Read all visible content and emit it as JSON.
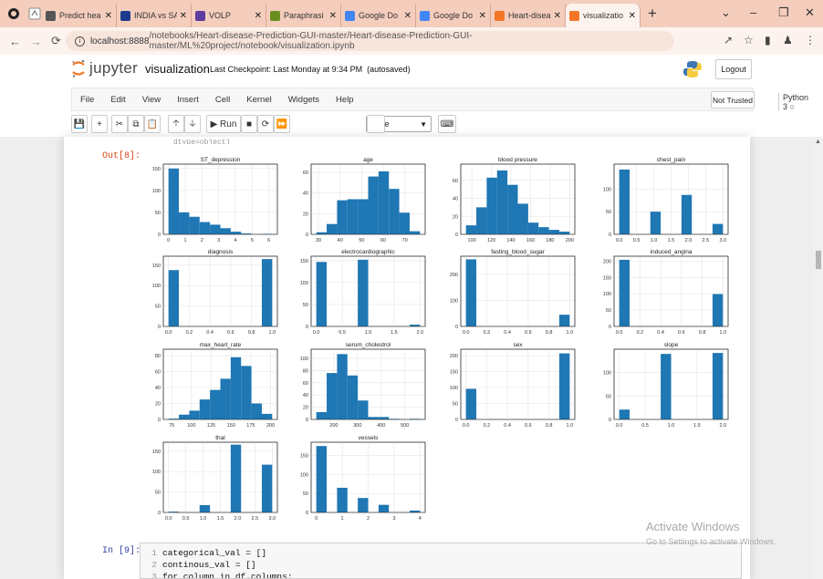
{
  "browser": {
    "tabs": [
      {
        "title": "Predict hea",
        "color": "#555555",
        "icon": "globe-icon"
      },
      {
        "title": "INDIA vs SA",
        "color": "#1a3b8c",
        "icon": "cricket-icon"
      },
      {
        "title": "VOLP",
        "color": "#5e3ca0",
        "icon": "volp-icon"
      },
      {
        "title": "Paraphrasi",
        "color": "#6b8e23",
        "icon": "quill-icon"
      },
      {
        "title": "Google Do",
        "color": "#4285f4",
        "icon": "google-icon"
      },
      {
        "title": "Google Do",
        "color": "#4285f4",
        "icon": "docs-icon"
      },
      {
        "title": "Heart-disea",
        "color": "#f37726",
        "icon": "jupyter-icon"
      },
      {
        "title": "visualizatio",
        "color": "#f37726",
        "icon": "jupyter-icon",
        "active": true
      }
    ],
    "url_host": "localhost:8888",
    "url_path": "/notebooks/Heart-disease-Prediction-GUI-master/Heart-disease-Prediction-GUI-master/ML%20project/notebook/visualization.ipynb"
  },
  "jupyter": {
    "logo_text": "jupyter",
    "notebook_name": "visualization",
    "checkpoint": "Last Checkpoint: Last Monday at 9:34 PM",
    "autosave": "(autosaved)",
    "logout_label": "Logout",
    "menus": [
      "File",
      "Edit",
      "View",
      "Insert",
      "Cell",
      "Kernel",
      "Widgets",
      "Help"
    ],
    "trusted_label": "Not Trusted",
    "kernel_label": "Python 3",
    "run_label": "Run",
    "cell_type": "Code"
  },
  "output_prompt": "Out[8]:",
  "input_prompt": "In [9]:",
  "residue_text": "dtype=object)",
  "code_lines": [
    {
      "n": "1",
      "text": "categorical_val = []"
    },
    {
      "n": "2",
      "text": "continous_val = []"
    },
    {
      "n": "3",
      "text": "for column in df.columns:"
    }
  ],
  "watermark": {
    "line1": "Activate Windows",
    "line2": "Go to Settings to activate Windows."
  },
  "colors": {
    "bar": "#1f77b4",
    "tab_strip": "#f5cdbd",
    "address_bar": "#fdf3ee",
    "out_prompt": "#d84315",
    "in_prompt": "#303f9f"
  },
  "chart_data": [
    {
      "type": "bar",
      "title": "ST_depression",
      "x_ticks": [
        "0",
        "1",
        "2",
        "3",
        "4",
        "5",
        "6"
      ],
      "x_range": [
        0,
        6.2
      ],
      "y_ticks": [
        "0",
        "50",
        "100",
        "150"
      ],
      "y_range": [
        0,
        160
      ],
      "bins": [
        [
          0,
          0.62,
          150
        ],
        [
          0.62,
          1.24,
          50
        ],
        [
          1.24,
          1.86,
          40
        ],
        [
          1.86,
          2.48,
          28
        ],
        [
          2.48,
          3.1,
          22
        ],
        [
          3.1,
          3.72,
          14
        ],
        [
          3.72,
          4.34,
          6
        ],
        [
          4.34,
          4.96,
          2
        ],
        [
          4.96,
          5.58,
          0
        ],
        [
          5.58,
          6.2,
          1
        ]
      ]
    },
    {
      "type": "bar",
      "title": "age",
      "x_ticks": [
        "30",
        "40",
        "50",
        "60",
        "70"
      ],
      "x_range": [
        29,
        77
      ],
      "y_ticks": [
        "0",
        "20",
        "40",
        "60"
      ],
      "y_range": [
        0,
        68
      ],
      "bins": [
        [
          29,
          33.8,
          2
        ],
        [
          33.8,
          38.6,
          10
        ],
        [
          38.6,
          43.4,
          33
        ],
        [
          43.4,
          48.2,
          34
        ],
        [
          48.2,
          53,
          34
        ],
        [
          53,
          57.8,
          56
        ],
        [
          57.8,
          62.6,
          61
        ],
        [
          62.6,
          67.4,
          44
        ],
        [
          67.4,
          72.2,
          21
        ],
        [
          72.2,
          77,
          3
        ]
      ]
    },
    {
      "type": "bar",
      "title": "blood pressure",
      "x_ticks": [
        "100",
        "120",
        "140",
        "160",
        "180",
        "200"
      ],
      "x_range": [
        94,
        200
      ],
      "y_ticks": [
        "0",
        "20",
        "40",
        "60"
      ],
      "y_range": [
        0,
        78
      ],
      "bins": [
        [
          94,
          104.6,
          10
        ],
        [
          104.6,
          115.2,
          30
        ],
        [
          115.2,
          125.8,
          63
        ],
        [
          125.8,
          136.4,
          71
        ],
        [
          136.4,
          147,
          55
        ],
        [
          147,
          157.6,
          34
        ],
        [
          157.6,
          168.2,
          13
        ],
        [
          168.2,
          178.8,
          8
        ],
        [
          178.8,
          189.4,
          5
        ],
        [
          189.4,
          200,
          3
        ]
      ]
    },
    {
      "type": "bar",
      "title": "chest_pain",
      "x_ticks": [
        "0.0",
        "0.5",
        "1.0",
        "1.5",
        "2.0",
        "2.5",
        "3.0"
      ],
      "x_range": [
        0,
        3
      ],
      "y_ticks": [
        "0",
        "50",
        "100"
      ],
      "y_range": [
        0,
        155
      ],
      "bins": [
        [
          0,
          0.3,
          143
        ],
        [
          0.9,
          1.2,
          50
        ],
        [
          1.8,
          2.1,
          87
        ],
        [
          2.7,
          3,
          23
        ]
      ]
    },
    {
      "type": "bar",
      "title": "diagnosis",
      "x_ticks": [
        "0.0",
        "0.2",
        "0.4",
        "0.6",
        "0.8",
        "1.0"
      ],
      "x_range": [
        0,
        1
      ],
      "y_ticks": [
        "0",
        "50",
        "100",
        "150"
      ],
      "y_range": [
        0,
        172
      ],
      "bins": [
        [
          0,
          0.1,
          138
        ],
        [
          0.9,
          1,
          165
        ]
      ]
    },
    {
      "type": "bar",
      "title": "electrocardiographic",
      "x_ticks": [
        "0.0",
        "0.5",
        "1.0",
        "1.5",
        "2.0"
      ],
      "x_range": [
        0,
        2
      ],
      "y_ticks": [
        "0",
        "50",
        "100",
        "150"
      ],
      "y_range": [
        0,
        160
      ],
      "bins": [
        [
          0,
          0.2,
          147
        ],
        [
          0.8,
          1,
          152
        ],
        [
          1.8,
          2,
          4
        ]
      ]
    },
    {
      "type": "bar",
      "title": "fasting_blood_sugar",
      "x_ticks": [
        "0.0",
        "0.2",
        "0.4",
        "0.6",
        "0.8",
        "1.0"
      ],
      "x_range": [
        0,
        1
      ],
      "y_ticks": [
        "0",
        "100",
        "200"
      ],
      "y_range": [
        0,
        270
      ],
      "bins": [
        [
          0,
          0.1,
          258
        ],
        [
          0.9,
          1,
          45
        ]
      ]
    },
    {
      "type": "bar",
      "title": "induced_angina",
      "x_ticks": [
        "0.0",
        "0.2",
        "0.4",
        "0.6",
        "0.8",
        "1.0"
      ],
      "x_range": [
        0,
        1
      ],
      "y_ticks": [
        "0",
        "50",
        "100",
        "150",
        "200"
      ],
      "y_range": [
        0,
        215
      ],
      "bins": [
        [
          0,
          0.1,
          204
        ],
        [
          0.9,
          1,
          99
        ]
      ]
    },
    {
      "type": "bar",
      "title": "max_heart_rate",
      "x_ticks": [
        "75",
        "100",
        "125",
        "150",
        "175",
        "200"
      ],
      "x_range": [
        71,
        202
      ],
      "y_ticks": [
        "0",
        "20",
        "40",
        "60",
        "80"
      ],
      "y_range": [
        0,
        88
      ],
      "bins": [
        [
          71,
          84.1,
          1
        ],
        [
          84.1,
          97.2,
          6
        ],
        [
          97.2,
          110.3,
          11
        ],
        [
          110.3,
          123.4,
          25
        ],
        [
          123.4,
          136.5,
          37
        ],
        [
          136.5,
          149.6,
          51
        ],
        [
          149.6,
          162.7,
          78
        ],
        [
          162.7,
          175.8,
          67
        ],
        [
          175.8,
          188.9,
          20
        ],
        [
          188.9,
          202,
          7
        ]
      ]
    },
    {
      "type": "bar",
      "title": "serum_cholestrol",
      "x_ticks": [
        "200",
        "300",
        "400",
        "500"
      ],
      "x_range": [
        126,
        564
      ],
      "y_ticks": [
        "0",
        "20",
        "40",
        "60",
        "80",
        "100"
      ],
      "y_range": [
        0,
        115
      ],
      "bins": [
        [
          126,
          169.8,
          12
        ],
        [
          169.8,
          213.6,
          76
        ],
        [
          213.6,
          257.4,
          107
        ],
        [
          257.4,
          301.2,
          72
        ],
        [
          301.2,
          345,
          31
        ],
        [
          345,
          388.8,
          4
        ],
        [
          388.8,
          432.6,
          4
        ],
        [
          432.6,
          476.4,
          1
        ],
        [
          476.4,
          520.2,
          0
        ],
        [
          520.2,
          564,
          1
        ]
      ]
    },
    {
      "type": "bar",
      "title": "sex",
      "x_ticks": [
        "0.0",
        "0.2",
        "0.4",
        "0.6",
        "0.8",
        "1.0"
      ],
      "x_range": [
        0,
        1
      ],
      "y_ticks": [
        "0",
        "50",
        "100",
        "150",
        "200"
      ],
      "y_range": [
        0,
        220
      ],
      "bins": [
        [
          0,
          0.1,
          96
        ],
        [
          0.9,
          1,
          207
        ]
      ]
    },
    {
      "type": "bar",
      "title": "slope",
      "x_ticks": [
        "0.0",
        "0.5",
        "1.0",
        "1.5",
        "2.0"
      ],
      "x_range": [
        0,
        2
      ],
      "y_ticks": [
        "0",
        "50",
        "100"
      ],
      "y_range": [
        0,
        150
      ],
      "bins": [
        [
          0,
          0.2,
          21
        ],
        [
          0.8,
          1,
          140
        ],
        [
          1.8,
          2,
          142
        ]
      ]
    },
    {
      "type": "bar",
      "title": "thal",
      "x_ticks": [
        "0.0",
        "0.5",
        "1.0",
        "1.5",
        "2.0",
        "2.5",
        "3.0"
      ],
      "x_range": [
        0,
        3
      ],
      "y_ticks": [
        "0",
        "50",
        "100",
        "150"
      ],
      "y_range": [
        0,
        172
      ],
      "bins": [
        [
          0,
          0.3,
          2
        ],
        [
          0.9,
          1.2,
          18
        ],
        [
          1.8,
          2.1,
          166
        ],
        [
          2.7,
          3,
          117
        ]
      ]
    },
    {
      "type": "bar",
      "title": "vessels",
      "x_ticks": [
        "0",
        "1",
        "2",
        "3",
        "4"
      ],
      "x_range": [
        0,
        4
      ],
      "y_ticks": [
        "0",
        "50",
        "100",
        "150"
      ],
      "y_range": [
        0,
        185
      ],
      "bins": [
        [
          0,
          0.4,
          175
        ],
        [
          0.8,
          1.2,
          65
        ],
        [
          1.6,
          2,
          38
        ],
        [
          2.4,
          2.8,
          20
        ],
        [
          3.6,
          4,
          5
        ]
      ]
    }
  ]
}
